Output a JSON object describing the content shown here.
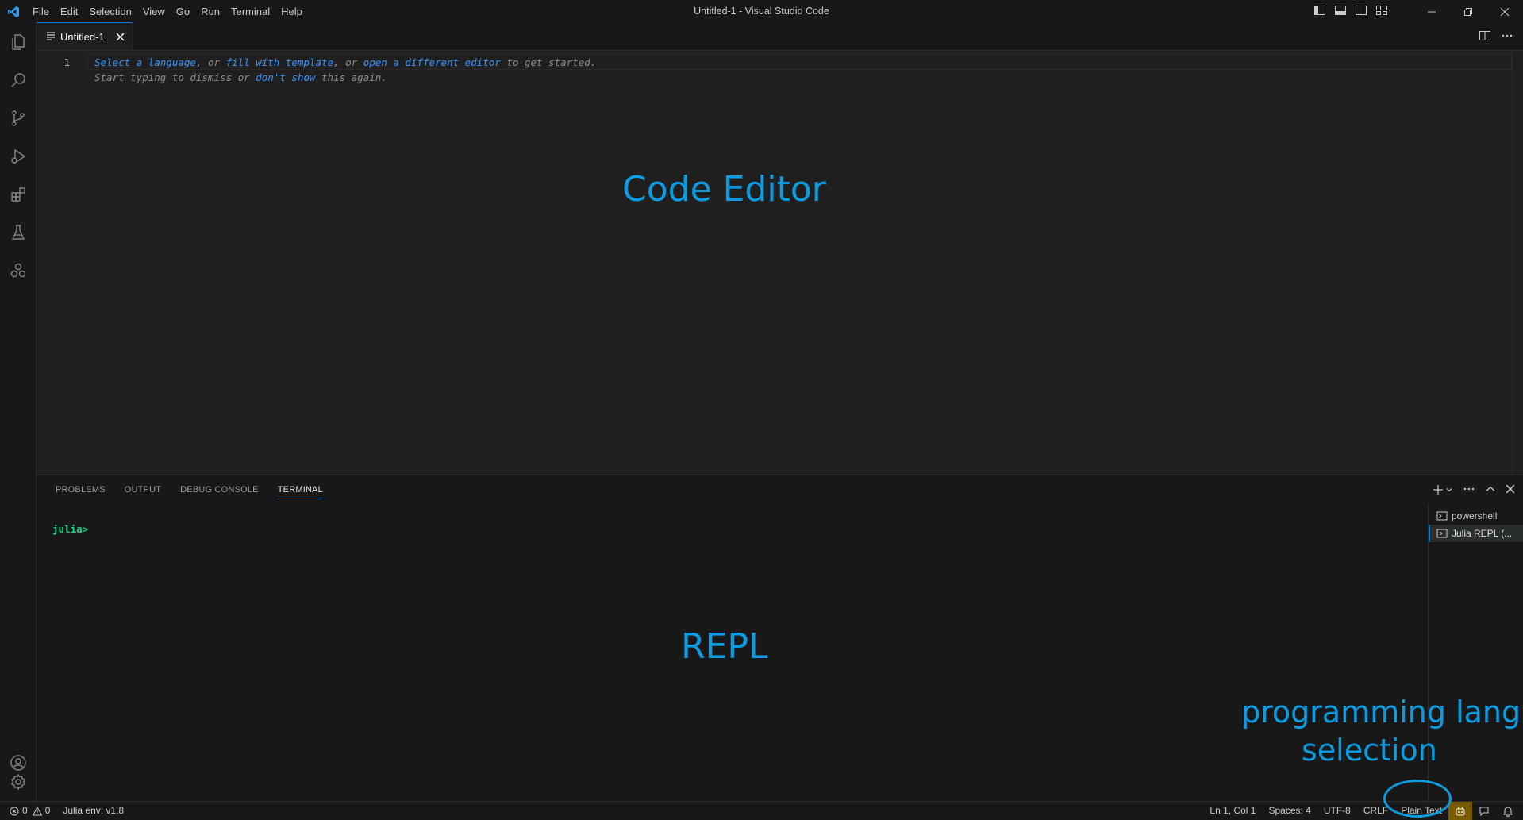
{
  "window": {
    "title": "Untitled-1 - Visual Studio Code"
  },
  "menu": [
    "File",
    "Edit",
    "Selection",
    "View",
    "Go",
    "Run",
    "Terminal",
    "Help"
  ],
  "activity_bar": {
    "top_icons": [
      "files-icon",
      "search-icon",
      "source-control-icon",
      "run-debug-icon",
      "extensions-icon",
      "testing-icon",
      "julia-icon"
    ],
    "bottom_icons": [
      "accounts-icon",
      "settings-gear-icon"
    ]
  },
  "editor": {
    "tab_label": "Untitled-1",
    "line_number": "1",
    "hint_line1": {
      "a": "Select a language",
      "b": ", or ",
      "c": "fill with template",
      "d": ", or ",
      "e": "open a different editor",
      "f": " to get started."
    },
    "hint_line2": {
      "a": "Start typing to dismiss or ",
      "b": "don't show",
      "c": " this again."
    }
  },
  "annotations": {
    "editor": "Code Editor",
    "repl": "REPL",
    "lang_line1": "programming language",
    "lang_line2": "selection",
    "color": "#0b9be0"
  },
  "panel": {
    "tabs": [
      "PROBLEMS",
      "OUTPUT",
      "DEBUG CONSOLE",
      "TERMINAL"
    ],
    "active_tab": "TERMINAL",
    "prompt": "julia>",
    "terminals": [
      "powershell",
      "Julia REPL (..."
    ]
  },
  "statusbar": {
    "errors": "0",
    "warnings": "0",
    "julia_env": "Julia env: v1.8",
    "position": "Ln 1, Col 1",
    "spaces": "Spaces: 4",
    "encoding": "UTF-8",
    "eol": "CRLF",
    "language": "Plain Text"
  },
  "colors": {
    "accent": "#0078d4",
    "link": "#3794ff",
    "prompt": "#23d18b",
    "copilot_bg": "#7a5c00"
  }
}
